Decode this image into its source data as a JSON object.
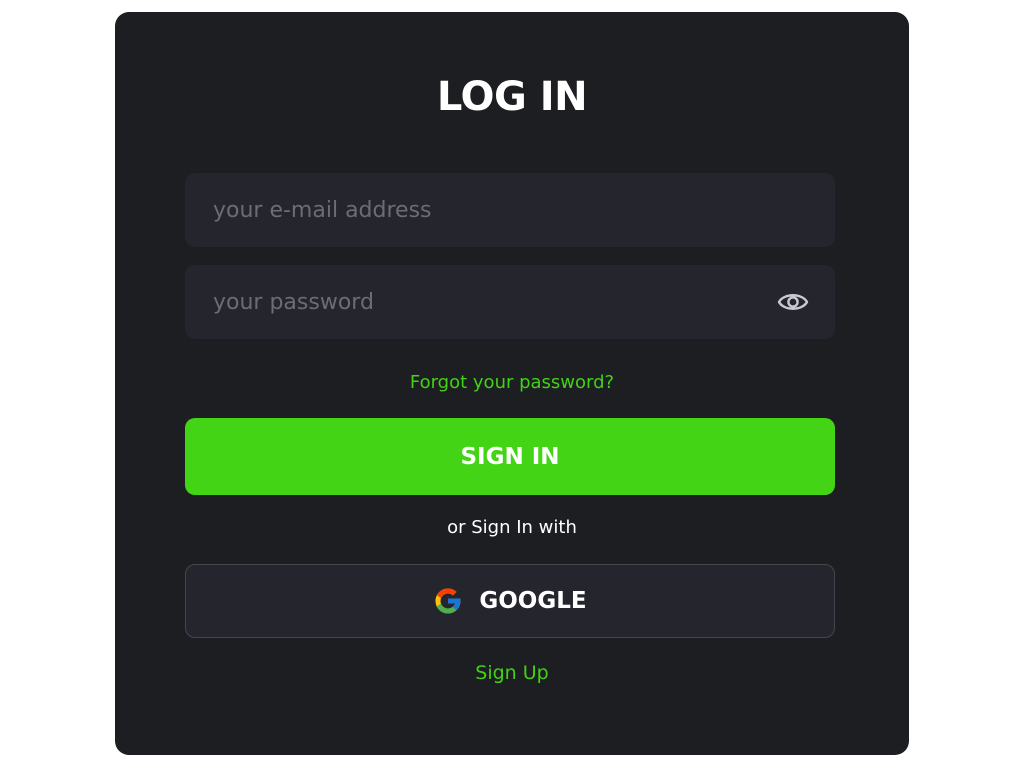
{
  "login": {
    "title": "LOG IN",
    "email": {
      "value": "",
      "placeholder": "your e-mail address"
    },
    "password": {
      "value": "",
      "placeholder": "your password"
    },
    "forgot_label": "Forgot your password?",
    "signin_label": "SIGN IN",
    "divider_text": "or Sign In with",
    "google_label": "GOOGLE",
    "signup_label": "Sign Up"
  },
  "colors": {
    "background": "#ffffff",
    "card": "#1d1e22",
    "field": "#25262d",
    "accent_green": "#44d416",
    "placeholder": "#6b6c75"
  },
  "icons": {
    "password_toggle": "eye-icon",
    "google": "google-logo-icon"
  }
}
